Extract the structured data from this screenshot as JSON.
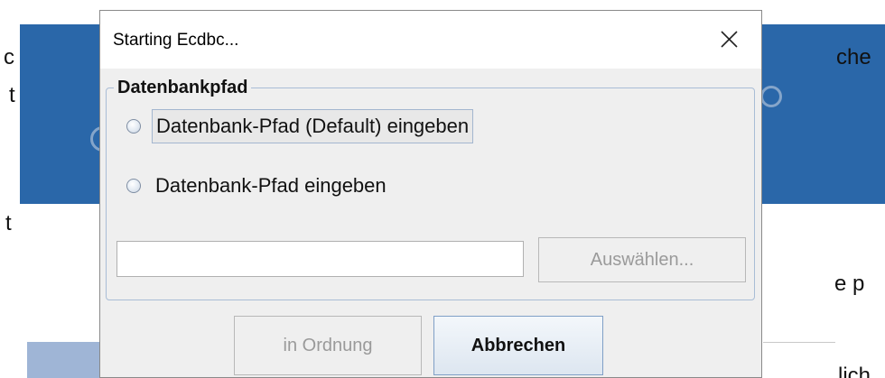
{
  "background": {
    "fragments": [
      "c",
      "t",
      "t",
      "che",
      "e p",
      "lich"
    ]
  },
  "dialog": {
    "title": "Starting Ecdbc...",
    "close_icon": "close-icon",
    "group": {
      "title": "Datenbankpfad",
      "radio_options": [
        {
          "label": "Datenbank-Pfad (Default) eingeben",
          "selected": false,
          "focused": true
        },
        {
          "label": "Datenbank-Pfad eingeben",
          "selected": false,
          "focused": false
        }
      ],
      "path_input": {
        "value": "",
        "placeholder": ""
      },
      "choose_button": "Auswählen..."
    },
    "buttons": {
      "ok": "in Ordnung",
      "cancel": "Abbrechen"
    }
  }
}
